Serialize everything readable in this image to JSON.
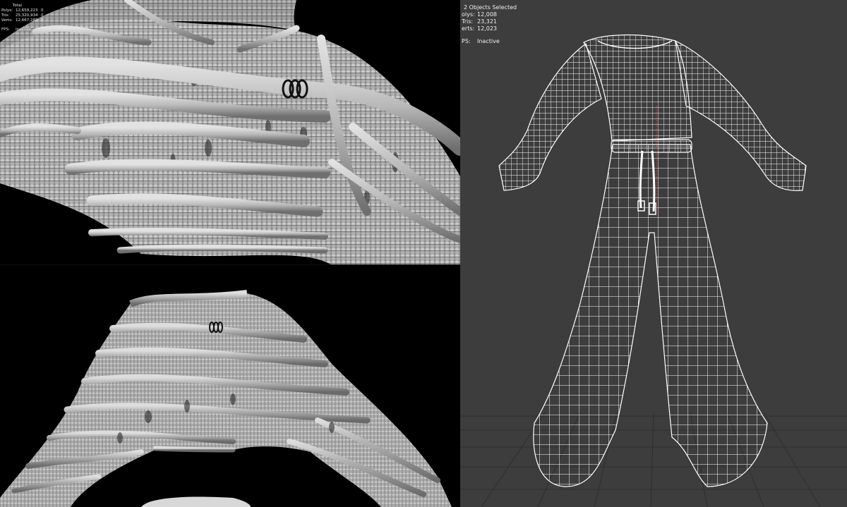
{
  "left_top_hud": {
    "header": "Total",
    "rows": [
      {
        "label": "Polys:",
        "value": "12,659,223",
        "sel": "0"
      },
      {
        "label": "Tris:",
        "value": "25,320,934",
        "sel": "0"
      },
      {
        "label": "Verts:",
        "value": "12,667,283",
        "sel": "0"
      }
    ],
    "fps_label": "FPS:",
    "fps_value": "Inactive"
  },
  "right_hud": {
    "selection": "2 Objects Selected",
    "rows": [
      {
        "label": "olys:",
        "value": "12,008"
      },
      {
        "label": "Tris:",
        "value": "23,321"
      },
      {
        "label": "erts:",
        "value": "12,023"
      }
    ],
    "fps_label": "PS:",
    "fps_value": "Inactive"
  },
  "colors": {
    "viewport_dark": "#000000",
    "viewport_grey": "#3d3d3d",
    "sculpt_grey": "#b5b5b5",
    "wire": "#ffffff",
    "grid": "#2e2e2e"
  }
}
